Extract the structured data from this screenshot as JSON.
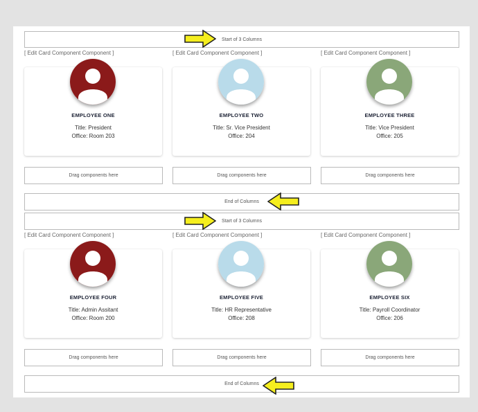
{
  "sections": [
    {
      "start_label": "Start of 3 Columns",
      "end_label": "End of Columns",
      "columns": [
        {
          "edit_label": "[ Edit Card Component Component ]",
          "drag_label": "Drag components here",
          "employee": {
            "name": "EMPLOYEE ONE",
            "title": "Title: President",
            "office": "Office: Room 203",
            "avatar_color": "#8b1a1a"
          }
        },
        {
          "edit_label": "[ Edit Card Component Component ]",
          "drag_label": "Drag components here",
          "employee": {
            "name": "EMPLOYEE TWO",
            "title": "Title: Sr. Vice President",
            "office": "Office: 204",
            "avatar_color": "#b9dbea"
          }
        },
        {
          "edit_label": "[ Edit Card Component Component ]",
          "drag_label": "Drag components here",
          "employee": {
            "name": "EMPLOYEE THREE",
            "title": "Title: Vice President",
            "office": "Office: 205",
            "avatar_color": "#8aa779"
          }
        }
      ]
    },
    {
      "start_label": "Start of 3 Columns",
      "end_label": "End of Columns",
      "columns": [
        {
          "edit_label": "[ Edit Card Component Component ]",
          "drag_label": "Drag components here",
          "employee": {
            "name": "EMPLOYEE FOUR",
            "title": "Title: Admin Assitant",
            "office": "Office: Room 200",
            "avatar_color": "#8b1a1a"
          }
        },
        {
          "edit_label": "[ Edit Card Component Component ]",
          "drag_label": "Drag components here",
          "employee": {
            "name": "EMPLOYEE FIVE",
            "title": "Title: HR Representative",
            "office": "Office: 208",
            "avatar_color": "#b9dbea"
          }
        },
        {
          "edit_label": "[ Edit Card Component Component ]",
          "drag_label": "Drag components here",
          "employee": {
            "name": "EMPLOYEE SIX",
            "title": "Title: Payroll Coordinator",
            "office": "Office: 206",
            "avatar_color": "#8aa779"
          }
        }
      ]
    }
  ],
  "colors": {
    "arrow_fill": "#f5ee1e",
    "arrow_stroke": "#222222"
  },
  "icons": {
    "arrow_right": "arrow-right-icon",
    "arrow_left": "arrow-left-icon",
    "avatar": "person-icon"
  }
}
